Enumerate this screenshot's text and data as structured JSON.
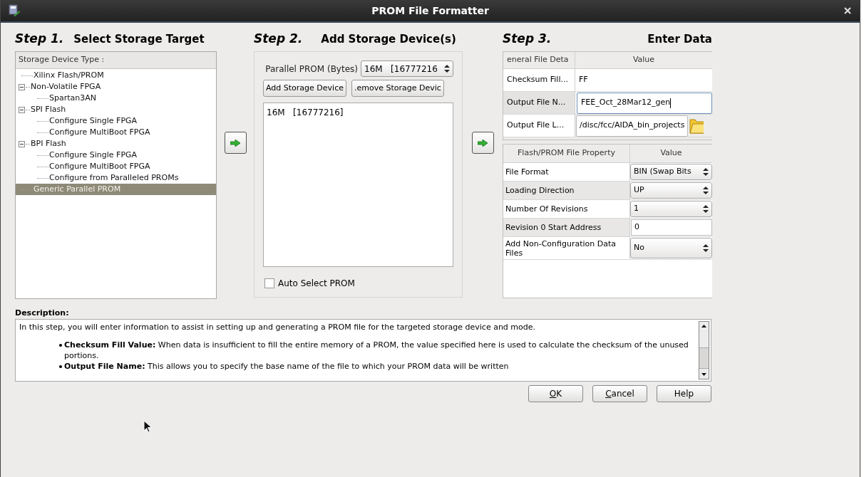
{
  "window": {
    "title": "PROM File Formatter"
  },
  "step1": {
    "step": "Step 1.",
    "title": "Select Storage Target",
    "column": "Storage Device Type :",
    "tree": [
      {
        "label": "Xilinx Flash/PROM",
        "selected": false
      },
      {
        "label": "Non-Volatile FPGA",
        "expanded": true,
        "selected": false,
        "children": [
          {
            "label": "Spartan3AN",
            "selected": false
          }
        ]
      },
      {
        "label": "SPI Flash",
        "expanded": true,
        "selected": false,
        "children": [
          {
            "label": "Configure Single FPGA",
            "selected": false
          },
          {
            "label": "Configure MultiBoot FPGA",
            "selected": false
          }
        ]
      },
      {
        "label": "BPI Flash",
        "expanded": true,
        "selected": false,
        "children": [
          {
            "label": "Configure Single FPGA",
            "selected": false
          },
          {
            "label": "Configure MultiBoot FPGA",
            "selected": false
          },
          {
            "label": "Configure from Paralleled PROMs",
            "selected": false
          }
        ]
      },
      {
        "label": "Generic Parallel PROM",
        "selected": true
      }
    ]
  },
  "step2": {
    "step": "Step 2.",
    "title": "Add Storage Device(s)",
    "size_label": "Parallel PROM (Bytes)",
    "size_value": "16M   [16777216",
    "buttons": [
      "Add Storage Device",
      ".emove Storage Devic"
    ],
    "devices": [
      "16M   [16777216]"
    ],
    "auto_select": {
      "label": "Auto Select PROM",
      "checked": false
    }
  },
  "step3": {
    "step": "Step 3.",
    "title": "Enter Data",
    "general": {
      "columns": [
        "eneral File Deta",
        "Value"
      ],
      "rows": [
        {
          "label": "Checksum Fill...",
          "value": "FF",
          "kind": "text",
          "focused": false
        },
        {
          "label": "Output File N...",
          "value": "FEE_Oct_28Mar12_gen",
          "kind": "text",
          "focused": true
        },
        {
          "label": "Output File L...",
          "value": "/disc/fcc/AIDA_bin_projects",
          "kind": "browse",
          "focused": false
        }
      ]
    },
    "properties": {
      "columns": [
        "Flash/PROM File Property",
        "Value"
      ],
      "rows": [
        {
          "label": "File Format",
          "value": "BIN (Swap Bits",
          "kind": "dropdown"
        },
        {
          "label": "Loading Direction",
          "value": "UP",
          "kind": "dropdown"
        },
        {
          "label": "Number Of Revisions",
          "value": "1",
          "kind": "dropdown"
        },
        {
          "label": "Revision 0 Start Address",
          "value": "0",
          "kind": "text"
        },
        {
          "label": "Add Non-Configuration Data Files",
          "value": "No",
          "kind": "dropdown"
        }
      ]
    }
  },
  "description": {
    "label": "Description:",
    "intro": "In this step, you will enter information to assist in setting up and generating a PROM file for the targeted storage device and mode.",
    "bullets": [
      "**Checksum Fill Value:** When data is insufficient to fill the entire memory of a PROM, the value specified here is used to calculate the checksum of the unused portions.",
      "**Output File Name:** This allows you to specify the base name of the file to which your PROM data will be written"
    ]
  },
  "buttons": [
    {
      "label": "OK",
      "mnemonic": true
    },
    {
      "label": "Cancel",
      "mnemonic": true
    },
    {
      "label": "Help",
      "mnemonic": false
    }
  ]
}
